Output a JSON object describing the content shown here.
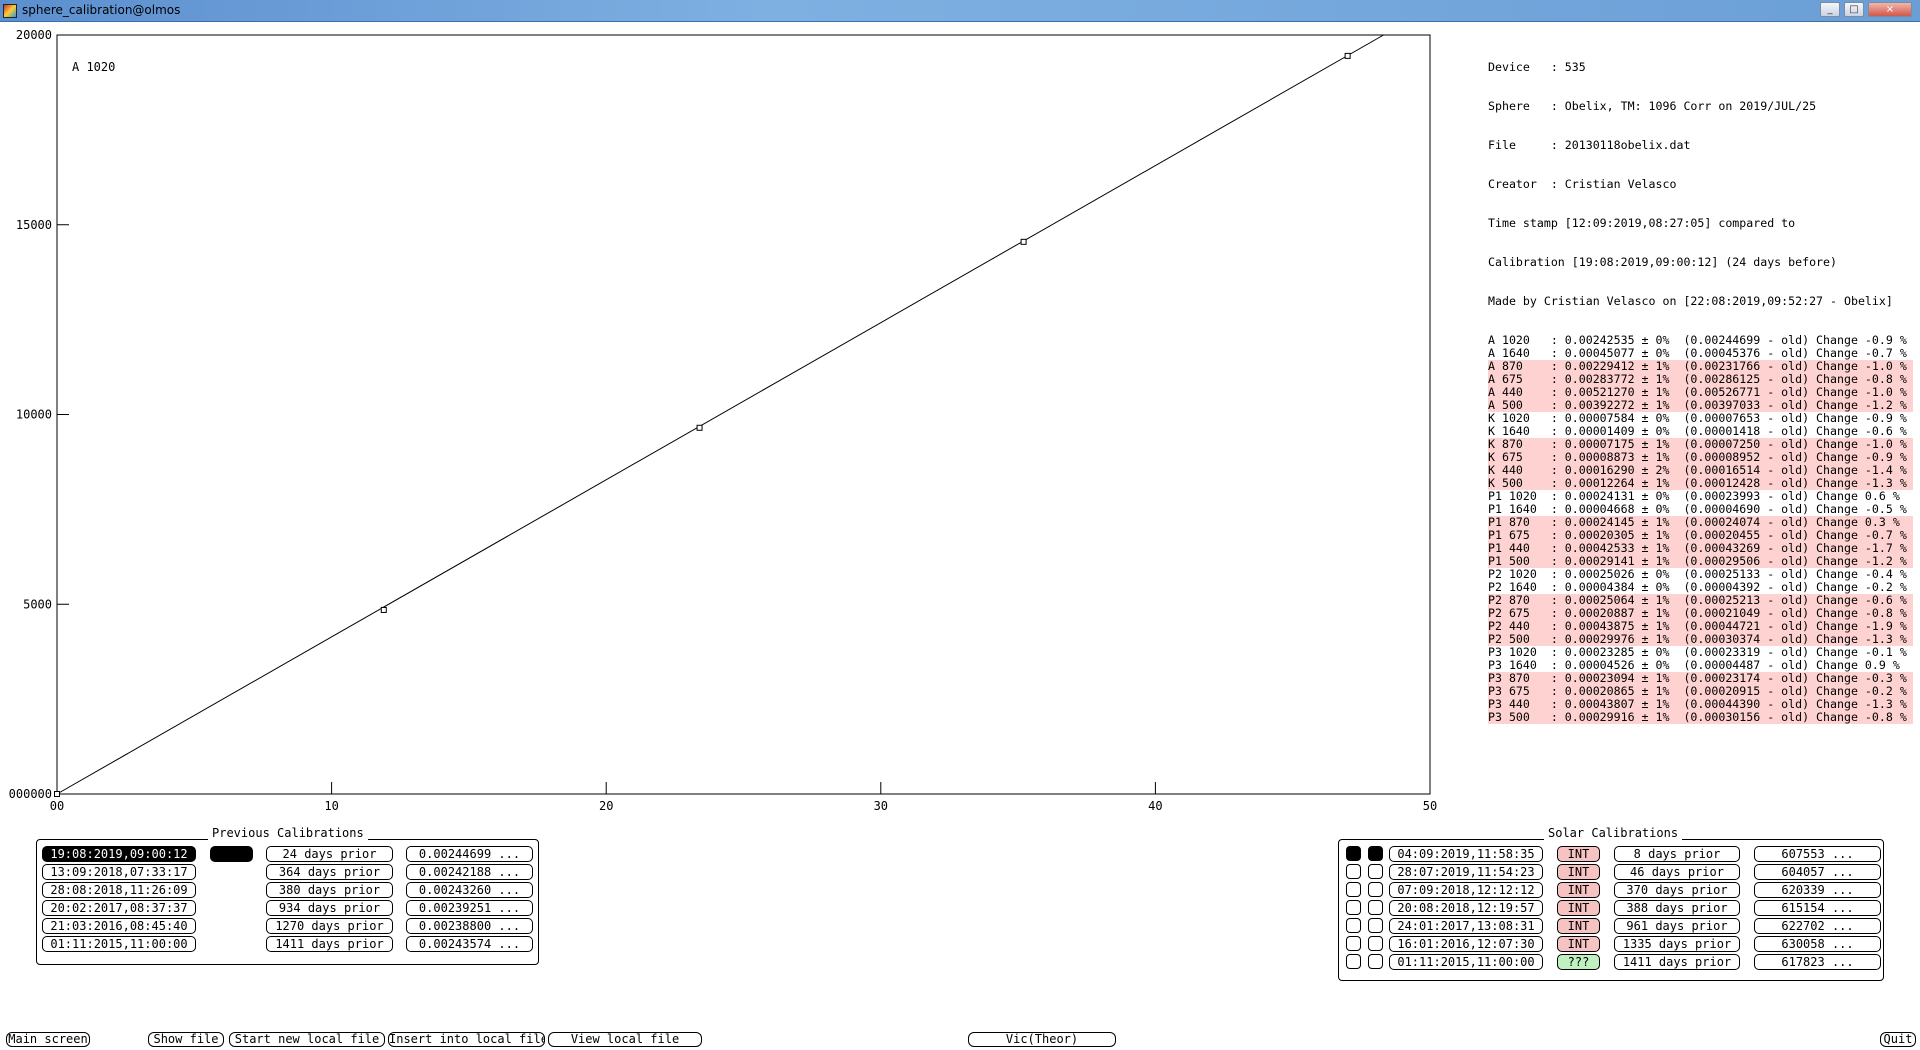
{
  "window": {
    "title": "sphere_calibration@olmos",
    "controls": [
      "_",
      "□",
      "×"
    ]
  },
  "chart_data": {
    "type": "scatter",
    "label": "A 1020",
    "xlim": [
      0,
      50
    ],
    "ylim": [
      0,
      20000
    ],
    "x_ticks": [
      "00",
      "10",
      "20",
      "30",
      "40",
      "50"
    ],
    "y_ticks": [
      "000000",
      "5000",
      "10000",
      "15000",
      "20000"
    ],
    "points": [
      {
        "x": 0,
        "y": 0
      },
      {
        "x": 11.9,
        "y": 4850
      },
      {
        "x": 23.4,
        "y": 9650
      },
      {
        "x": 35.2,
        "y": 14550
      },
      {
        "x": 47.0,
        "y": 19450
      }
    ],
    "fit_line": {
      "slope": 414,
      "intercept": 0
    }
  },
  "info": {
    "header": [
      "Device   : 535",
      "Sphere   : Obelix, TM: 1096 Corr on 2019/JUL/25",
      "File     : 20130118obelix.dat",
      "Creator  : Cristian Velasco",
      "Time stamp [12:09:2019,08:27:05] compared to",
      "Calibration [19:08:2019,09:00:12] (24 days before)",
      "Made by Cristian Velasco on [22:08:2019,09:52:27 - Obelix]"
    ],
    "rows": [
      {
        "text": "A 1020   : 0.00242535 ± 0%  (0.00244699 - old) Change -0.9 %",
        "hl": false
      },
      {
        "text": "A 1640   : 0.00045077 ± 0%  (0.00045376 - old) Change -0.7 %",
        "hl": false
      },
      {
        "text": "A 870    : 0.00229412 ± 1%  (0.00231766 - old) Change -1.0 %",
        "hl": true
      },
      {
        "text": "A 675    : 0.00283772 ± 1%  (0.00286125 - old) Change -0.8 %",
        "hl": true
      },
      {
        "text": "A 440    : 0.00521270 ± 1%  (0.00526771 - old) Change -1.0 %",
        "hl": true
      },
      {
        "text": "A 500    : 0.00392272 ± 1%  (0.00397033 - old) Change -1.2 %",
        "hl": true
      },
      {
        "text": "K 1020   : 0.00007584 ± 0%  (0.00007653 - old) Change -0.9 %",
        "hl": false
      },
      {
        "text": "K 1640   : 0.00001409 ± 0%  (0.00001418 - old) Change -0.6 %",
        "hl": false
      },
      {
        "text": "K 870    : 0.00007175 ± 1%  (0.00007250 - old) Change -1.0 %",
        "hl": true
      },
      {
        "text": "K 675    : 0.00008873 ± 1%  (0.00008952 - old) Change -0.9 %",
        "hl": true
      },
      {
        "text": "K 440    : 0.00016290 ± 2%  (0.00016514 - old) Change -1.4 %",
        "hl": true
      },
      {
        "text": "K 500    : 0.00012264 ± 1%  (0.00012428 - old) Change -1.3 %",
        "hl": true
      },
      {
        "text": "P1 1020  : 0.00024131 ± 0%  (0.00023993 - old) Change 0.6 %",
        "hl": false
      },
      {
        "text": "P1 1640  : 0.00004668 ± 0%  (0.00004690 - old) Change -0.5 %",
        "hl": false
      },
      {
        "text": "P1 870   : 0.00024145 ± 1%  (0.00024074 - old) Change 0.3 %",
        "hl": true
      },
      {
        "text": "P1 675   : 0.00020305 ± 1%  (0.00020455 - old) Change -0.7 %",
        "hl": true
      },
      {
        "text": "P1 440   : 0.00042533 ± 1%  (0.00043269 - old) Change -1.7 %",
        "hl": true
      },
      {
        "text": "P1 500   : 0.00029141 ± 1%  (0.00029506 - old) Change -1.2 %",
        "hl": true
      },
      {
        "text": "P2 1020  : 0.00025026 ± 0%  (0.00025133 - old) Change -0.4 %",
        "hl": false
      },
      {
        "text": "P2 1640  : 0.00004384 ± 0%  (0.00004392 - old) Change -0.2 %",
        "hl": false
      },
      {
        "text": "P2 870   : 0.00025064 ± 1%  (0.00025213 - old) Change -0.6 %",
        "hl": true
      },
      {
        "text": "P2 675   : 0.00020887 ± 1%  (0.00021049 - old) Change -0.8 %",
        "hl": true
      },
      {
        "text": "P2 440   : 0.00043875 ± 1%  (0.00044721 - old) Change -1.9 %",
        "hl": true
      },
      {
        "text": "P2 500   : 0.00029976 ± 1%  (0.00030374 - old) Change -1.3 %",
        "hl": true
      },
      {
        "text": "P3 1020  : 0.00023285 ± 0%  (0.00023319 - old) Change -0.1 %",
        "hl": false
      },
      {
        "text": "P3 1640  : 0.00004526 ± 0%  (0.00004487 - old) Change 0.9 %",
        "hl": false
      },
      {
        "text": "P3 870   : 0.00023094 ± 1%  (0.00023174 - old) Change -0.3 %",
        "hl": true
      },
      {
        "text": "P3 675   : 0.00020865 ± 1%  (0.00020915 - old) Change -0.2 %",
        "hl": true
      },
      {
        "text": "P3 440   : 0.00043807 ± 1%  (0.00044390 - old) Change -1.3 %",
        "hl": true
      },
      {
        "text": "P3 500   : 0.00029916 ± 1%  (0.00030156 - old) Change -0.8 %",
        "hl": true
      }
    ]
  },
  "previous": {
    "title": "Previous Calibrations",
    "rows": [
      {
        "date": "19:08:2019,09:00:12",
        "prior": "24 days prior",
        "value": "0.00244699 ...",
        "selected": true
      },
      {
        "date": "13:09:2018,07:33:17",
        "prior": "364 days prior",
        "value": "0.00242188 ...",
        "selected": false
      },
      {
        "date": "28:08:2018,11:26:09",
        "prior": "380 days prior",
        "value": "0.00243260 ...",
        "selected": false
      },
      {
        "date": "20:02:2017,08:37:37",
        "prior": "934 days prior",
        "value": "0.00239251 ...",
        "selected": false
      },
      {
        "date": "21:03:2016,08:45:40",
        "prior": "1270 days prior",
        "value": "0.00238800 ...",
        "selected": false
      },
      {
        "date": "01:11:2015,11:00:00",
        "prior": "1411 days prior",
        "value": "0.00243574 ...",
        "selected": false
      }
    ]
  },
  "solar": {
    "title": "Solar Calibrations",
    "rows": [
      {
        "date": "04:09:2019,11:58:35",
        "type": "INT",
        "prior": "8 days prior",
        "value": "607553 ...",
        "on": true
      },
      {
        "date": "28:07:2019,11:54:23",
        "type": "INT",
        "prior": "46 days prior",
        "value": "604057 ...",
        "on": false
      },
      {
        "date": "07:09:2018,12:12:12",
        "type": "INT",
        "prior": "370 days prior",
        "value": "620339 ...",
        "on": false
      },
      {
        "date": "20:08:2018,12:19:57",
        "type": "INT",
        "prior": "388 days prior",
        "value": "615154 ...",
        "on": false
      },
      {
        "date": "24:01:2017,13:08:31",
        "type": "INT",
        "prior": "961 days prior",
        "value": "622702 ...",
        "on": false
      },
      {
        "date": "16:01:2016,12:07:30",
        "type": "INT",
        "prior": "1335 days prior",
        "value": "630058 ...",
        "on": false
      },
      {
        "date": "01:11:2015,11:00:00",
        "type": "???",
        "prior": "1411 days prior",
        "value": "617823 ...",
        "on": false
      }
    ]
  },
  "buttons": {
    "main_screen": "Main screen",
    "show_file": "Show file",
    "start_new": "Start new local file",
    "insert": "Insert into local file",
    "view": "View local file",
    "vic": "Vic(Theor)",
    "quit": "Quit"
  }
}
